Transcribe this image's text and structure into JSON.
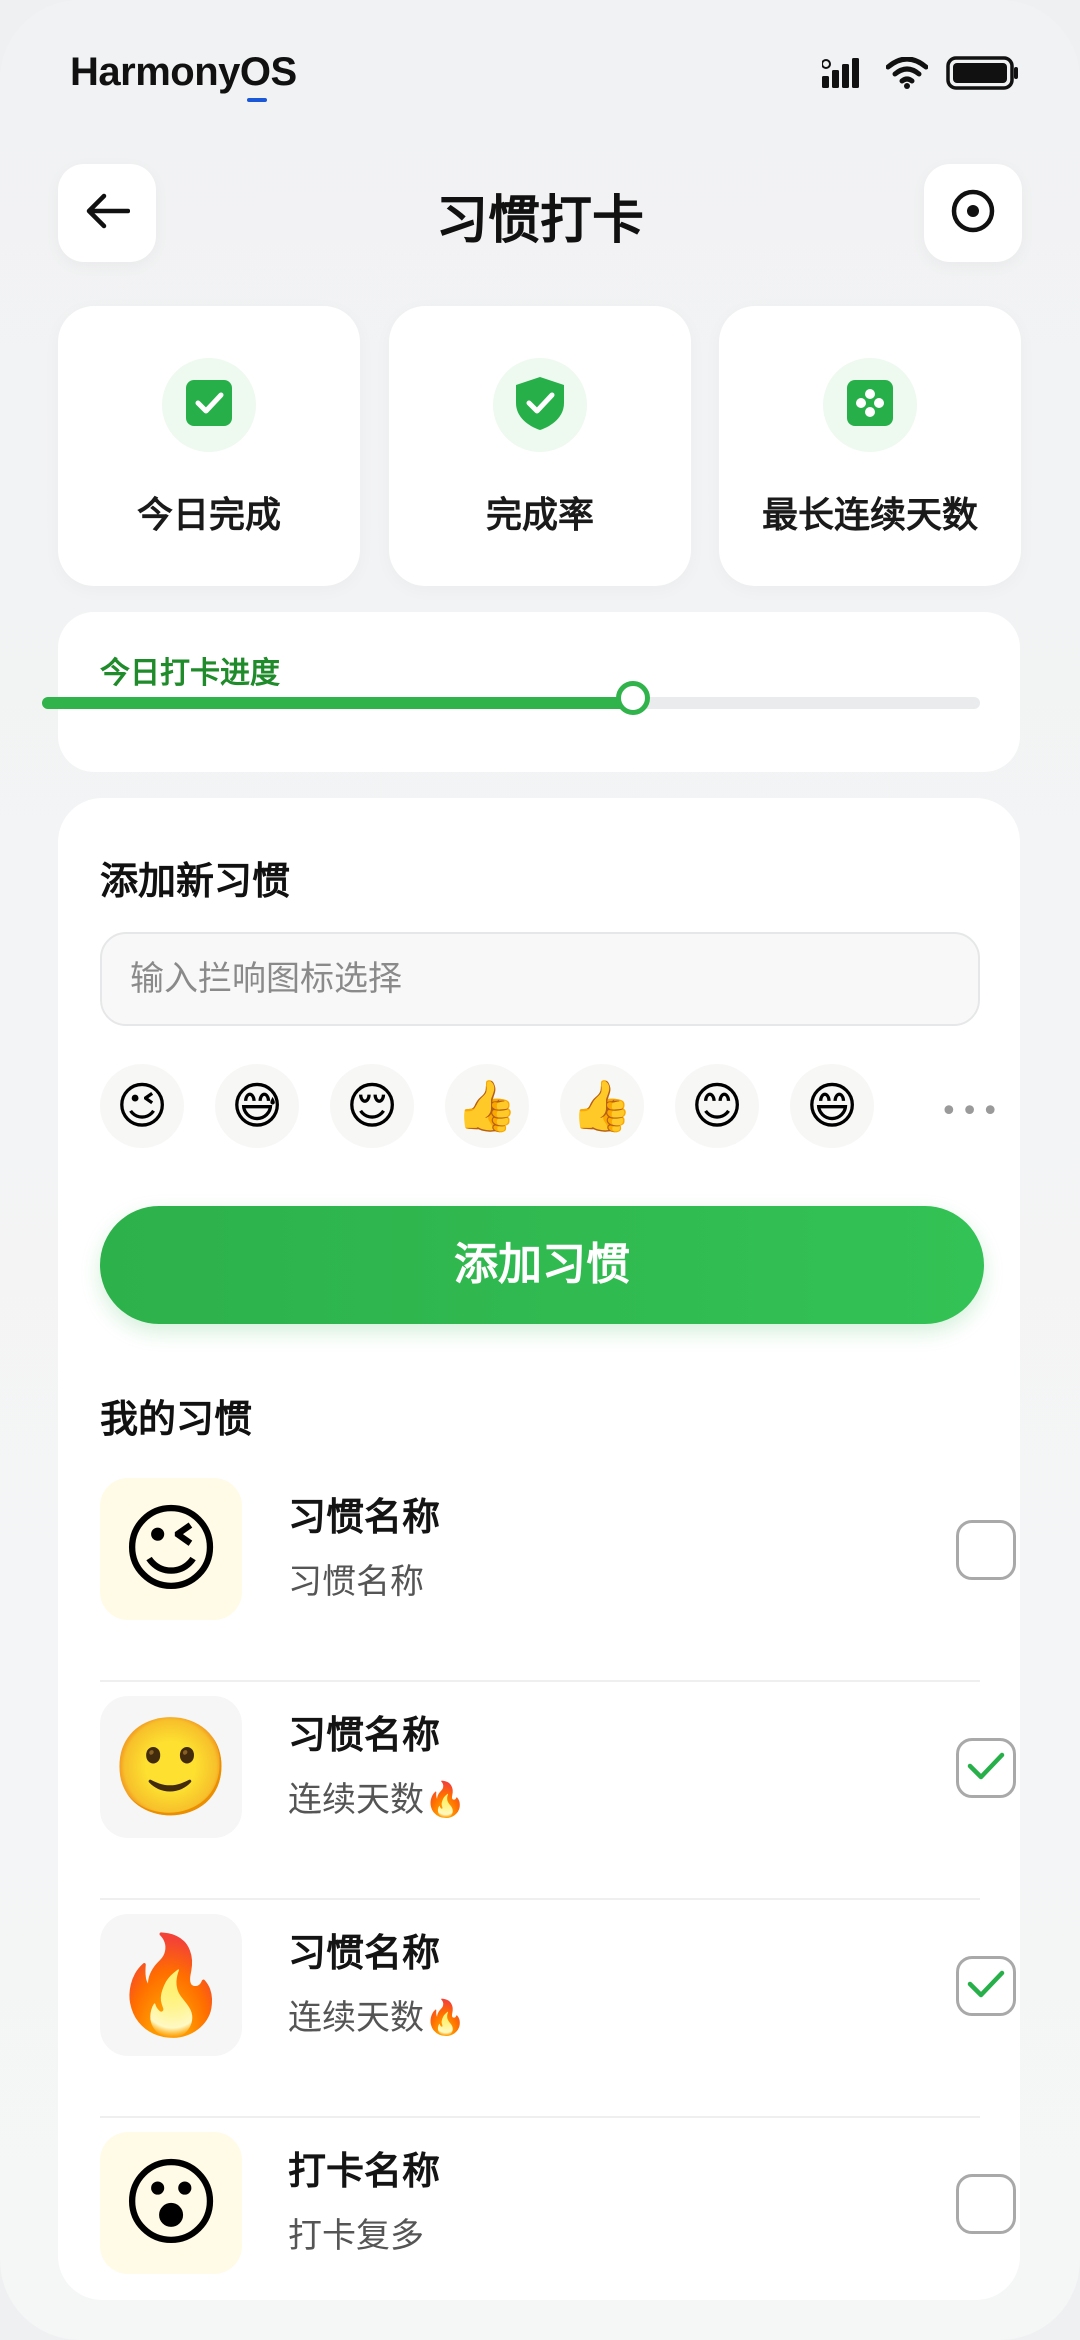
{
  "status_bar": {
    "brand": "HarmonyOS",
    "signal_icon": "signal-icon",
    "wifi_icon": "wifi-icon",
    "battery_icon": "battery-icon"
  },
  "header": {
    "title": "习惯打卡",
    "back_icon": "back-arrow-icon",
    "right_icon": "target-icon"
  },
  "stats": [
    {
      "label": "今日完成",
      "icon": "check-square-icon"
    },
    {
      "label": "完成率",
      "icon": "check-shield-icon"
    },
    {
      "label": "最长连续天数",
      "icon": "clover-icon"
    }
  ],
  "progress": {
    "label": "今日打卡进度",
    "value": 0.63
  },
  "add_habit": {
    "section_title": "添加新习惯",
    "input_placeholder": "输入拦响图标选择",
    "input_value": "",
    "emoji_options": [
      "😉",
      "😅",
      "😌",
      "👍",
      "👍",
      "😊",
      "😄"
    ],
    "more_label": "•••",
    "submit_label": "添加习惯"
  },
  "habits": {
    "section_title": "我的习惯",
    "items": [
      {
        "emoji": "😉",
        "title": "习惯名称",
        "subtitle": "习惯名称",
        "checked": false,
        "avatar_bg": "#fffbe6"
      },
      {
        "emoji": "🙂",
        "title": "习惯名称",
        "subtitle": "连续天数🔥",
        "checked": true,
        "avatar_bg": "#f7f7f7"
      },
      {
        "emoji": "🔥",
        "title": "习惯名称",
        "subtitle": "连续天数🔥",
        "checked": true,
        "avatar_bg": "#f7f7f7"
      },
      {
        "emoji": "😮",
        "title": "打卡名称",
        "subtitle": "打卡复多",
        "checked": false,
        "avatar_bg": "#fffbe6"
      }
    ]
  },
  "colors": {
    "accent": "#2fb34a",
    "accent_dark": "#1f8b2a",
    "background": "#f2f3f4",
    "card": "#ffffff"
  }
}
